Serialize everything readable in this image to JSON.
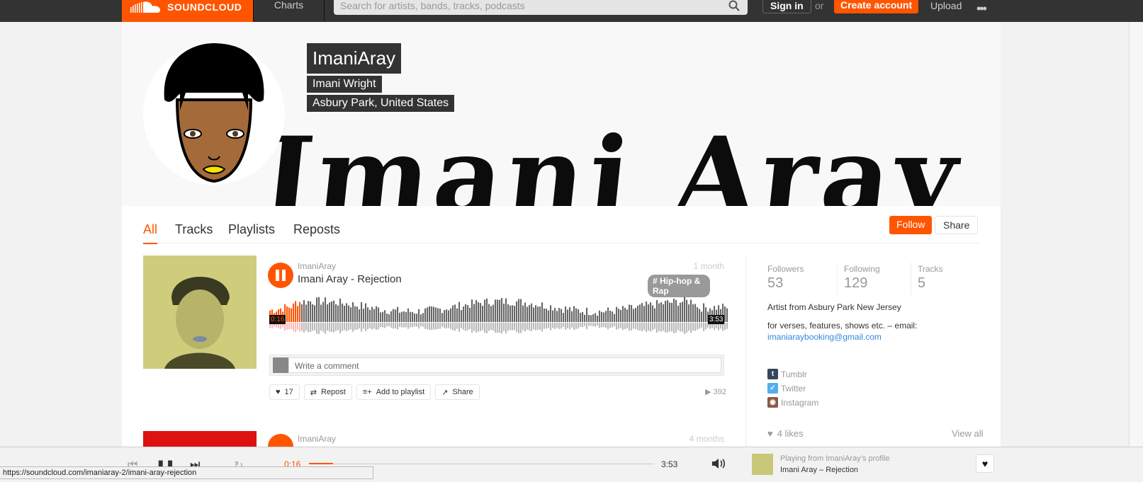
{
  "topbar": {
    "brand": "SOUNDCLOUD",
    "charts": "Charts",
    "search_placeholder": "Search for artists, bands, tracks, podcasts",
    "sign_in": "Sign in",
    "or": "or",
    "create_account": "Create account",
    "upload": "Upload",
    "more": "•••"
  },
  "profile": {
    "username": "ImaniAray",
    "full_name": "Imani Wright",
    "location": "Asbury Park, United States",
    "banner_text": "Imani Aray"
  },
  "tabs": [
    "All",
    "Tracks",
    "Playlists",
    "Reposts"
  ],
  "buttons": {
    "follow": "Follow",
    "share": "Share"
  },
  "track1": {
    "uploader": "ImaniAray",
    "title": "Imani Aray - Rejection",
    "date": "1 month",
    "genre": "# Hip-hop & Rap",
    "elapsed": "0:16",
    "duration": "3:53",
    "progress_fraction": 0.069,
    "comment_placeholder": "Write a comment",
    "likes": "17",
    "repost": "Repost",
    "add_to_playlist": "Add to playlist",
    "share": "Share",
    "plays": "392"
  },
  "track2": {
    "uploader": "ImaniAray",
    "date": "4 months"
  },
  "sidebar": {
    "followers_label": "Followers",
    "followers": "53",
    "following_label": "Following",
    "following": "129",
    "tracks_label": "Tracks",
    "tracks": "5",
    "bio_line1": "Artist from Asbury Park New Jersey",
    "bio_line2": "for verses, features, shows etc. – email:",
    "email": "imaniaraybooking@gmail.com",
    "links": [
      {
        "label": "Tumblr",
        "icon": "tumblr-icon",
        "color": "#35465c"
      },
      {
        "label": "Twitter",
        "icon": "twitter-icon",
        "color": "#55acee"
      },
      {
        "label": "Instagram",
        "icon": "instagram-icon",
        "color": "#8a5a44"
      }
    ],
    "likes": "4 likes",
    "view_all": "View all"
  },
  "player": {
    "elapsed": "0:16",
    "duration": "3:53",
    "progress_fraction": 0.069,
    "playing_from": "Playing from ImaniAray’s profile",
    "now_playing": "Imani Aray – Rejection"
  },
  "status_url": "https://soundcloud.com/imaniaray-2/imani-aray-rejection",
  "colors": {
    "accent": "#ff5500",
    "topbar": "#333333"
  }
}
